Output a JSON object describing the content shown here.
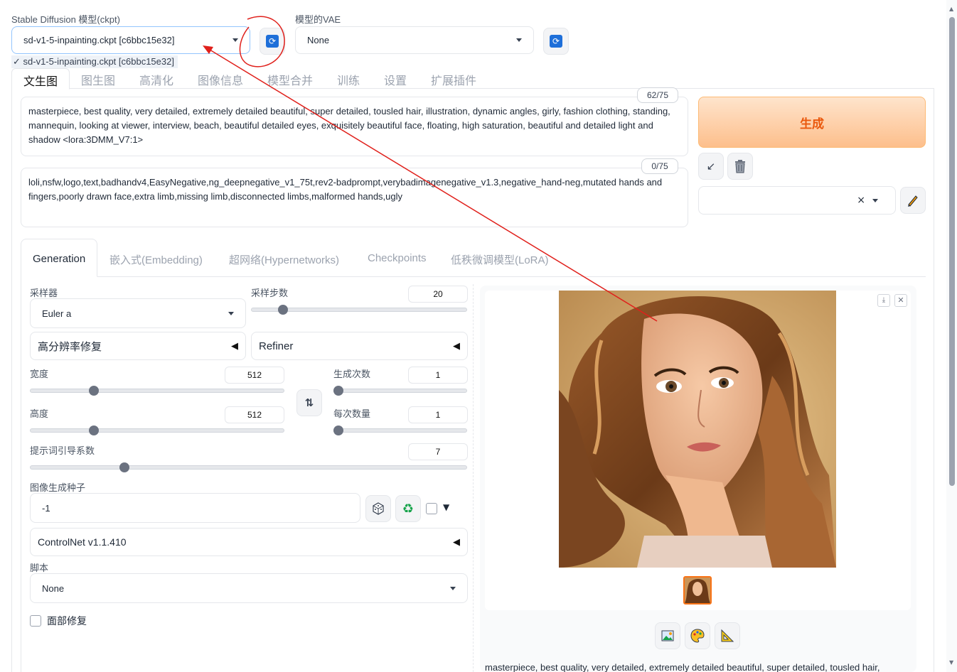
{
  "model": {
    "label": "Stable Diffusion 模型(ckpt)",
    "value": "sd-v1-5-inpainting.ckpt [c6bbc15e32]",
    "dropdown_option": "✓ sd-v1-5-inpainting.ckpt [c6bbc15e32]"
  },
  "vae": {
    "label": "模型的VAE",
    "value": "None"
  },
  "icons": {
    "refresh": "refresh-icon",
    "send": "send-icon",
    "trash": "trash-icon",
    "pencil": "pencil-icon",
    "dice": "dice-icon",
    "recycle": "recycle-icon",
    "swap": "swap-icon",
    "image": "image-icon",
    "palette": "palette-icon",
    "ruler": "ruler-icon",
    "download": "download-icon",
    "close": "close-icon"
  },
  "tabs": [
    "文生图",
    "图生图",
    "高清化",
    "图像信息",
    "模型合并",
    "训练",
    "设置",
    "扩展插件"
  ],
  "prompt": {
    "counter": "62/75",
    "text": "masterpiece, best quality, very detailed, extremely detailed beautiful, super detailed, tousled hair, illustration, dynamic angles, girly, fashion clothing, standing, mannequin, looking at viewer, interview, beach, beautiful detailed eyes, exquisitely beautiful face, floating, high saturation, beautiful and detailed light and shadow <lora:3DMM_V7:1>"
  },
  "negative": {
    "counter": "0/75",
    "text": "loli,nsfw,logo,text,badhandv4,EasyNegative,ng_deepnegative_v1_75t,rev2-badprompt,verybadimagenegative_v1.3,negative_hand-neg,mutated hands and fingers,poorly drawn face,extra limb,missing limb,disconnected limbs,malformed hands,ugly"
  },
  "generate_label": "生成",
  "style_clear": "×",
  "gen_tabs": [
    "Generation",
    "嵌入式(Embedding)",
    "超网络(Hypernetworks)",
    "Checkpoints",
    "低秩微调模型(LoRA)"
  ],
  "sampler": {
    "label": "采样器",
    "value": "Euler a"
  },
  "steps": {
    "label": "采样步数",
    "value": "20",
    "fraction": 0.13
  },
  "hires": {
    "label": "高分辨率修复"
  },
  "refiner": {
    "label": "Refiner"
  },
  "width": {
    "label": "宽度",
    "value": "512",
    "fraction": 0.24
  },
  "height": {
    "label": "高度",
    "value": "512",
    "fraction": 0.24
  },
  "batch_count": {
    "label": "生成次数",
    "value": "1",
    "fraction": 0.0
  },
  "batch_size": {
    "label": "每次数量",
    "value": "1",
    "fraction": 0.0
  },
  "cfg": {
    "label": "提示词引导系数",
    "value": "7",
    "fraction": 0.21
  },
  "seed": {
    "label": "图像生成种子",
    "value": "-1"
  },
  "controlnet": {
    "label": "ControlNet v1.1.410"
  },
  "script": {
    "label": "脚本",
    "value": "None"
  },
  "face_restore": {
    "label": "面部修复"
  },
  "output_caption": "masterpiece, best quality, very detailed, extremely detailed beautiful, super detailed, tousled hair,",
  "colors": {
    "accent": "#f97316",
    "annotation": "#e0201b",
    "generate_bg": "#fdd2ac"
  }
}
